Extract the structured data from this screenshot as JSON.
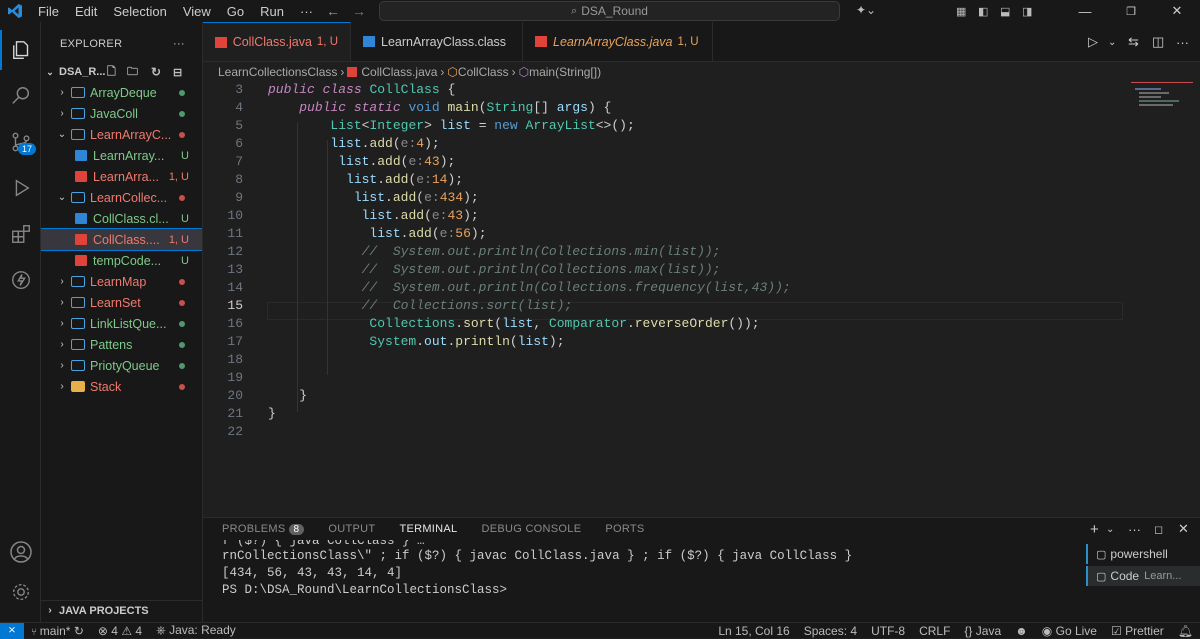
{
  "menu": [
    "File",
    "Edit",
    "Selection",
    "View",
    "Go",
    "Run",
    "···"
  ],
  "search_text": "DSA_Round",
  "explorer": {
    "title": "EXPLORER",
    "root": "DSA_R...",
    "items": [
      {
        "label": "ArrayDeque",
        "kind": "folder",
        "indent": 1,
        "color": "#d9a23a",
        "dot": "#4e9a6a",
        "name_color": "#7fc98a"
      },
      {
        "label": "JavaColl",
        "kind": "folder",
        "indent": 1,
        "color": "#d9a23a",
        "dot": "#4e9a6a",
        "name_color": "#7fc98a"
      },
      {
        "label": "LearnArrayC...",
        "kind": "folder-open",
        "indent": 1,
        "color": "#d9a23a",
        "dot": "#c94f4f",
        "name_color": "#f07a6e"
      },
      {
        "label": "LearnArray...",
        "kind": "file-class",
        "indent": 2,
        "badge": "U",
        "name_color": "#7fc98a"
      },
      {
        "label": "LearnArra...",
        "kind": "file-java",
        "indent": 2,
        "badge": "1, U",
        "name_color": "#f07a6e"
      },
      {
        "label": "LearnCollec...",
        "kind": "folder-open",
        "indent": 1,
        "color": "#d9a23a",
        "dot": "#c94f4f",
        "name_color": "#f07a6e"
      },
      {
        "label": "CollClass.cl...",
        "kind": "file-class",
        "indent": 2,
        "badge": "U",
        "name_color": "#7fc98a"
      },
      {
        "label": "CollClass....",
        "kind": "file-java",
        "indent": 2,
        "badge": "1, U",
        "name_color": "#f07a6e",
        "selected": true
      },
      {
        "label": "tempCode...",
        "kind": "file-java",
        "indent": 2,
        "badge": "U",
        "name_color": "#7fc98a"
      },
      {
        "label": "LearnMap",
        "kind": "folder",
        "indent": 1,
        "color": "#d9a23a",
        "dot": "#c94f4f",
        "name_color": "#f07a6e"
      },
      {
        "label": "LearnSet",
        "kind": "folder",
        "indent": 1,
        "color": "#d9a23a",
        "dot": "#c94f4f",
        "name_color": "#f07a6e"
      },
      {
        "label": "LinkListQue...",
        "kind": "folder",
        "indent": 1,
        "color": "#d9a23a",
        "dot": "#4e9a6a",
        "name_color": "#7fc98a"
      },
      {
        "label": "Pattens",
        "kind": "folder",
        "indent": 1,
        "color": "#d9a23a",
        "dot": "#4e9a6a",
        "name_color": "#7fc98a"
      },
      {
        "label": "PriotyQueue",
        "kind": "folder",
        "indent": 1,
        "color": "#d9a23a",
        "dot": "#4e9a6a",
        "name_color": "#7fc98a"
      },
      {
        "label": "Stack",
        "kind": "folder-special",
        "indent": 1,
        "color": "#e0a040",
        "dot": "#c94f4f",
        "name_color": "#f07a6e"
      }
    ],
    "java_projects": "JAVA PROJECTS"
  },
  "scm_badge": "17",
  "tabs": [
    {
      "label": "CollClass.java",
      "badge": "1, U",
      "active": true,
      "color": "#f07a6e",
      "italic": false,
      "icon": "java"
    },
    {
      "label": "LearnArrayClass.class",
      "badge": "",
      "active": false,
      "color": "#ccc",
      "italic": false,
      "icon": "class"
    },
    {
      "label": "LearnArrayClass.java",
      "badge": "1, U",
      "active": false,
      "color": "#e8a25b",
      "italic": true,
      "icon": "java"
    }
  ],
  "breadcrumb": [
    "LearnCollectionsClass",
    "CollClass.java",
    "CollClass",
    "main(String[])"
  ],
  "line_numbers": [
    "3",
    "4",
    "5",
    "6",
    "7",
    "8",
    "9",
    "10",
    "11",
    "12",
    "13",
    "14",
    "15",
    "16",
    "17",
    "18",
    "19",
    "20",
    "21",
    "22"
  ],
  "current_line": "15",
  "panel": {
    "tabs": [
      "PROBLEMS",
      "OUTPUT",
      "TERMINAL",
      "DEBUG CONSOLE",
      "PORTS"
    ],
    "problems_count": "8",
    "active_tab": "TERMINAL",
    "terminal_lines": [
      "f ($?) { java CollClass } …",
      "rnCollectionsClass\\\" ; if ($?) { javac CollClass.java } ; if ($?) { java CollClass }",
      "[434, 56, 43, 43, 14, 4]",
      "PS D:\\DSA_Round\\LearnCollectionsClass>"
    ],
    "terminals": [
      {
        "label": "powershell"
      },
      {
        "label": "Code",
        "sub": "Learn..."
      }
    ]
  },
  "status": {
    "branch": "main*",
    "errors": "4",
    "warnings": "4",
    "java": "Java: Ready",
    "position": "Ln 15, Col 16",
    "spaces": "Spaces: 4",
    "encoding": "UTF-8",
    "eol": "CRLF",
    "lang": "Java",
    "golive": "Go Live",
    "prettier": "Prettier"
  },
  "colors": {
    "accent": "#0078d4",
    "error": "#f07a6e",
    "modified": "#7fc98a"
  }
}
